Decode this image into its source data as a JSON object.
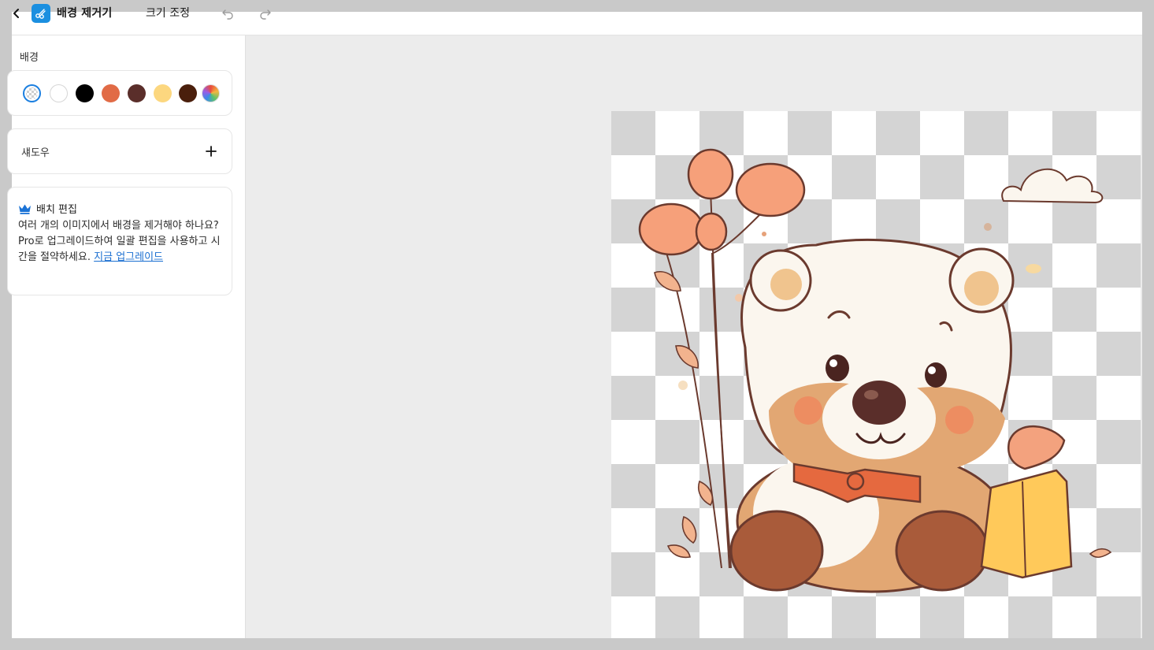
{
  "header": {
    "back_icon": "chevron-left-icon",
    "app_icon": "scissors-icon",
    "app_title": "배경 제거기",
    "resize_tab": "크기 조정",
    "undo_icon": "undo-icon",
    "redo_icon": "redo-icon"
  },
  "sidebar": {
    "background_label": "배경",
    "swatches": [
      {
        "name": "transparent",
        "color": "checker",
        "selected": true
      },
      {
        "name": "white",
        "color": "#ffffff"
      },
      {
        "name": "black",
        "color": "#000000"
      },
      {
        "name": "orange",
        "color": "#e16b46"
      },
      {
        "name": "brown",
        "color": "#5a2e2a"
      },
      {
        "name": "yellow",
        "color": "#fcd77f"
      },
      {
        "name": "dark-brown",
        "color": "#4a1f0c"
      },
      {
        "name": "custom",
        "color": "rainbow"
      }
    ],
    "shadow_label": "섀도우",
    "shadow_add_icon": "plus-icon",
    "batch": {
      "icon": "crown-icon",
      "title": "배치 편집",
      "description": "여러 개의 이미지에서 배경을 제거해야 하나요? Pro로 업그레이드하여 일괄 편집을 사용하고 시간을 절약하세요.",
      "link": "지금 업그레이드"
    }
  },
  "canvas": {
    "image_subject": "teddy-bear-with-balloons-and-gift",
    "checker_colors": [
      "#ffffff",
      "#d4d4d4"
    ]
  }
}
